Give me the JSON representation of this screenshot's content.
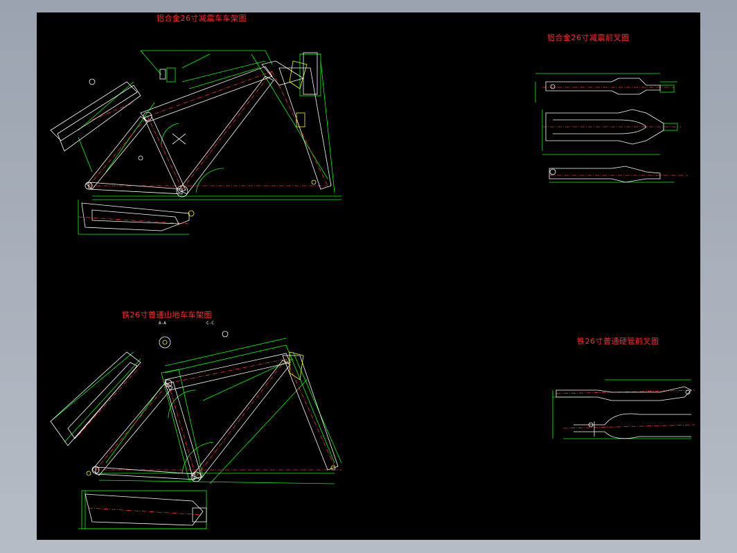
{
  "drawing": {
    "titles": {
      "alu_frame": "铝合金26寸减震车车架图",
      "alu_fork": "铝合金26寸减震前叉图",
      "iron_frame": "铁26寸普通山地车车架图",
      "iron_fork": "铁26寸普通硬管前叉图"
    },
    "section_labels": {
      "aa": "A-A",
      "cc": "C-C"
    }
  },
  "colors": {
    "background": "#000000",
    "outline": "#00ff00",
    "frame": "#ffffff",
    "center": "#ff3030",
    "accent": "#ffff00",
    "title": "#ff2a2a"
  }
}
